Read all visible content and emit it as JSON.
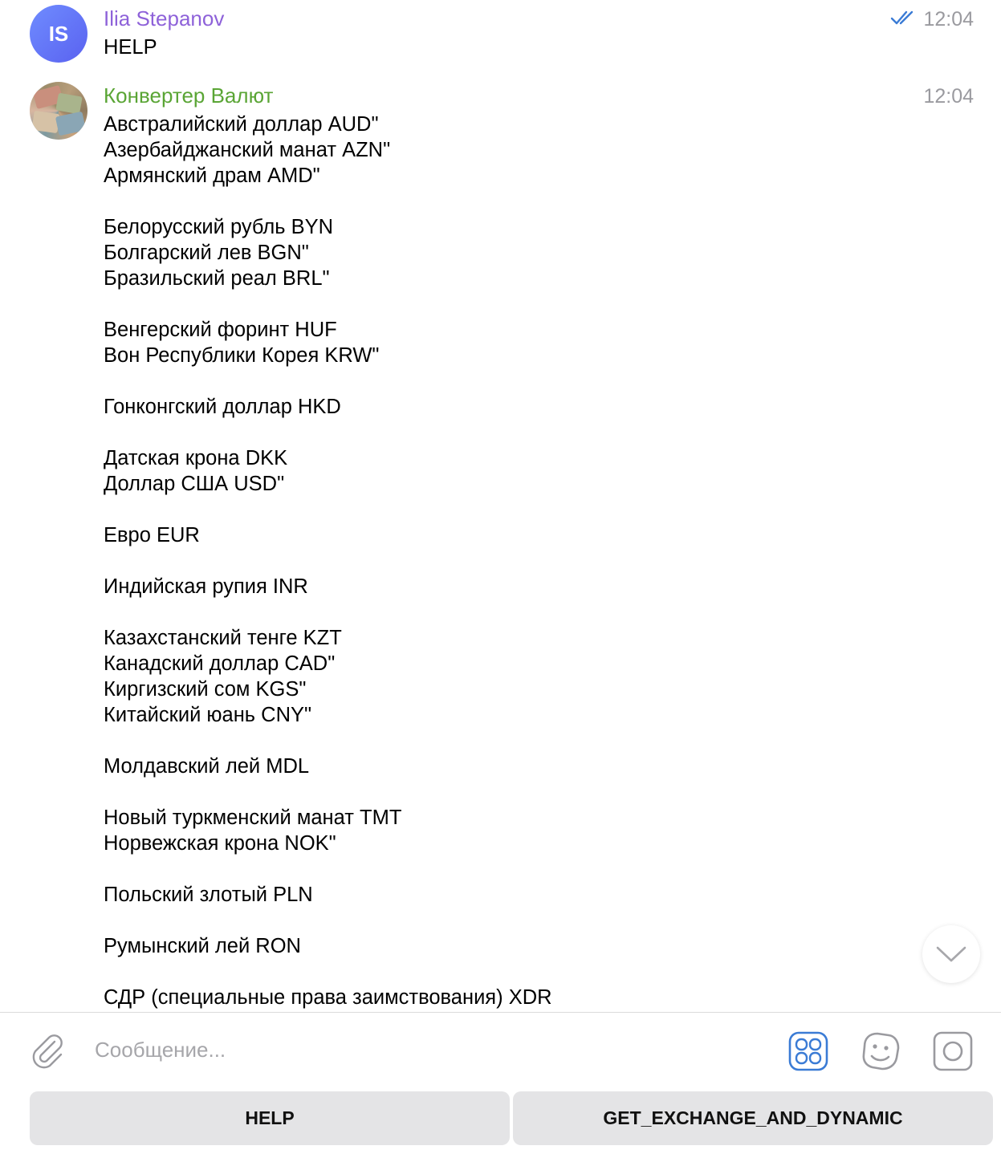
{
  "messages": [
    {
      "sender": "Ilia Stepanov",
      "avatar_initials": "IS",
      "time": "12:04",
      "text": "HELP"
    },
    {
      "sender": "Конвертер Валют",
      "time": "12:04",
      "text": "Австралийский доллар AUD\"\nАзербайджанский манат AZN\"\nАрмянский драм AMD\"\n\nБелорусский рубль BYN\nБолгарский лев BGN\"\nБразильский реал BRL\"\n\nВенгерский форинт HUF\nВон Республики Корея KRW\"\n\nГонконгский доллар HKD\n\nДатская крона DKK\nДоллар США USD\"\n\nЕвро EUR\n\nИндийская рупия INR\n\nКазахстанский тенге KZT\nКанадский доллар CAD\"\nКиргизский сом KGS\"\nКитайский юань CNY\"\n\nМолдавский лей MDL\n\nНовый туркменский манат TMT\nНорвежская крона NOK\"\n\nПольский злотый PLN\n\nРумынский лей RON\n\nСДР (специальные права заимствования) XDR"
    }
  ],
  "composer": {
    "placeholder": "Сообщение..."
  },
  "keyboard": {
    "buttons": [
      "HELP",
      "GET_EXCHANGE_AND_DYNAMIC"
    ]
  },
  "colors": {
    "sender_user": "#8e62d9",
    "sender_bot": "#5aa535",
    "accent": "#3a7bd5",
    "time": "#9a9a9f"
  }
}
